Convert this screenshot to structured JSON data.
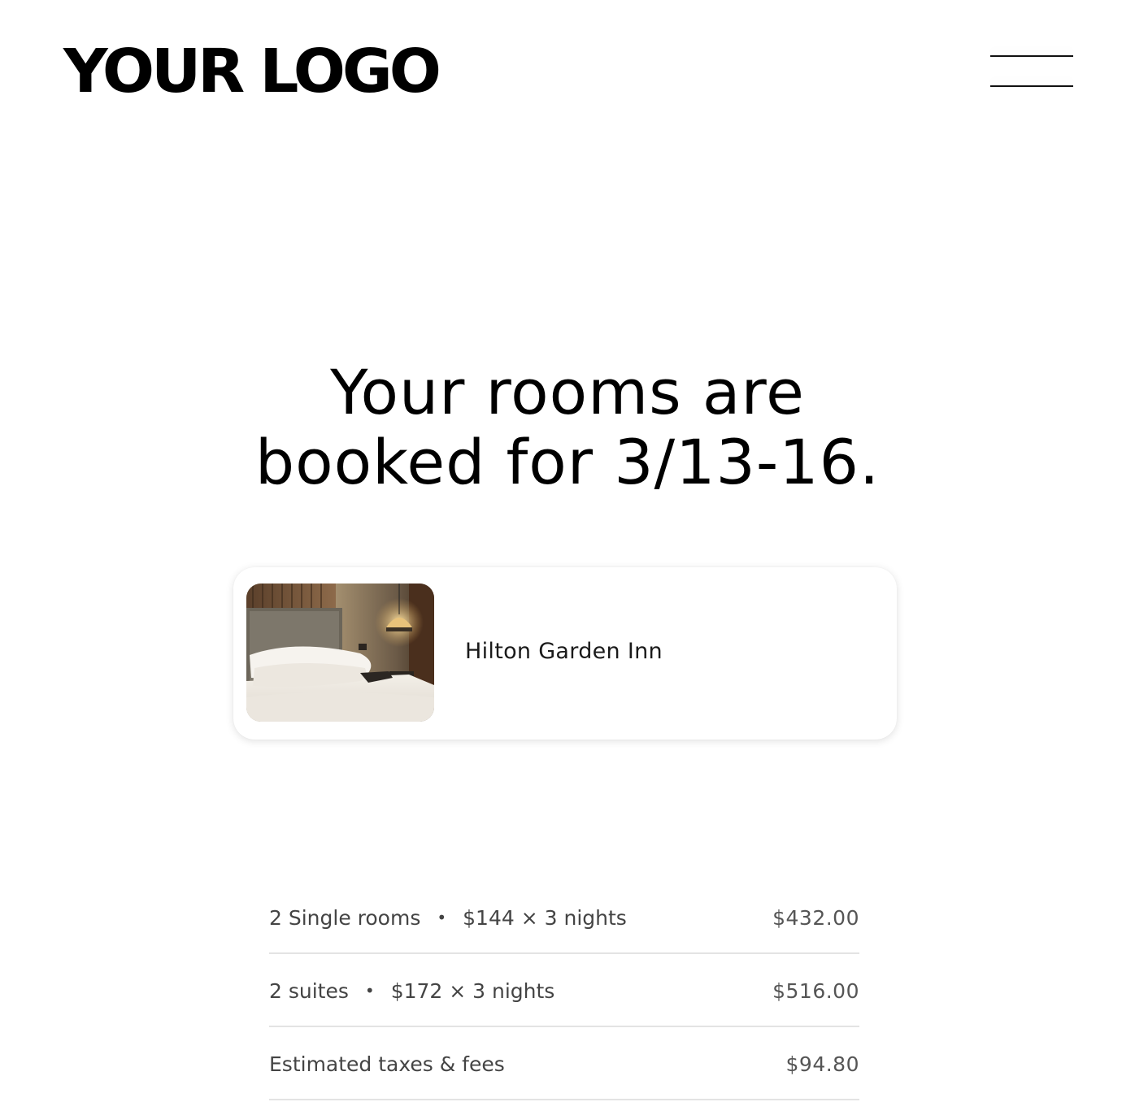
{
  "header": {
    "logo_text": "YOUR LOGO",
    "menu_icon": "hamburger-menu-icon"
  },
  "confirmation": {
    "headline_line1": "Your rooms are",
    "headline_line2": "booked for 3/13-16."
  },
  "hotel": {
    "name": "Hilton Garden Inn",
    "photo": "hotel-room-photo"
  },
  "pricing": {
    "rows": [
      {
        "label": "2 Single rooms",
        "separator": "•",
        "rate": "$144 × 3 nights",
        "amount": "$432.00"
      },
      {
        "label": "2 suites",
        "separator": "•",
        "rate": "$172 × 3 nights",
        "amount": "$516.00"
      },
      {
        "label": "Estimated taxes & fees",
        "amount": "$94.80"
      }
    ]
  },
  "colors": {
    "text_primary": "#000000",
    "text_secondary": "#444444",
    "divider": "#e3e3e3",
    "background": "#ffffff"
  }
}
